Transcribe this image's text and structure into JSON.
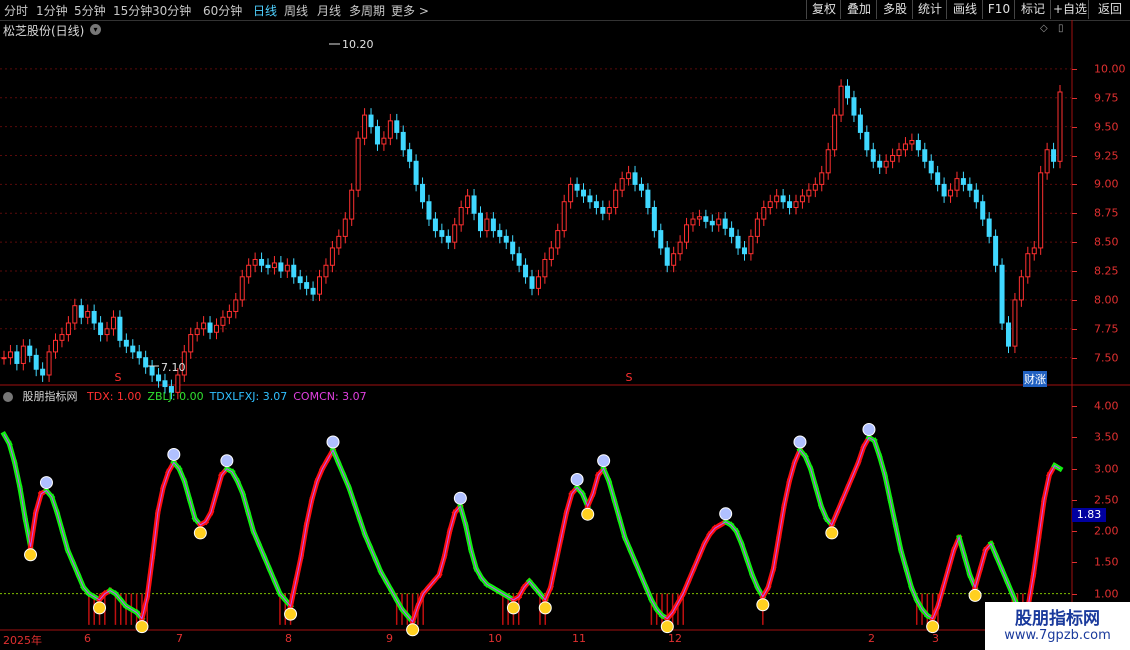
{
  "toolbar": {
    "periods": [
      "分时",
      "1分钟",
      "5分钟",
      "15分钟",
      "30分钟",
      "60分钟",
      "日线",
      "周线",
      "月线",
      "多周期",
      "更多 >"
    ],
    "active_period": "日线",
    "right_buttons": [
      "复权",
      "叠加",
      "多股",
      "统计",
      "画线",
      "F10",
      "标记",
      "+自选",
      "返回"
    ]
  },
  "main_chart": {
    "title": "松芝股份(日线)",
    "high_label": "10.20",
    "low_label": "7.10",
    "s_marker": "S",
    "badge": "财涨"
  },
  "indicator": {
    "name": "股朋指标网",
    "items": [
      {
        "label": "TDX: 1.00",
        "color": "#ff3030"
      },
      {
        "label": "ZBLJ: 0.00",
        "color": "#30e030"
      },
      {
        "label": "TDXLFXJ: 3.07",
        "color": "#30c0ff"
      },
      {
        "label": "COMCN: 3.07",
        "color": "#e040e0"
      }
    ],
    "current_value": "1.83"
  },
  "x_axis": {
    "year_label": "2025年",
    "months": [
      "6",
      "7",
      "8",
      "9",
      "10",
      "11",
      "12",
      "2",
      "3"
    ]
  },
  "watermark": {
    "line1": "股朋指标网",
    "line2": "www.7gpzb.com"
  },
  "chart_data": [
    {
      "type": "candlestick",
      "title": "松芝股份(日线)",
      "y_ticks": [
        "10.00",
        "9.75",
        "9.50",
        "9.25",
        "9.00",
        "8.75",
        "8.50",
        "8.25",
        "8.00",
        "7.75",
        "7.50"
      ],
      "ylim": [
        7.35,
        10.25
      ],
      "annotations": {
        "max": 10.2,
        "min": 7.1
      },
      "closes": [
        7.5,
        7.55,
        7.45,
        7.6,
        7.52,
        7.4,
        7.35,
        7.55,
        7.65,
        7.7,
        7.8,
        7.95,
        7.85,
        7.9,
        7.8,
        7.7,
        7.75,
        7.85,
        7.65,
        7.6,
        7.55,
        7.5,
        7.42,
        7.35,
        7.3,
        7.25,
        7.2,
        7.35,
        7.55,
        7.7,
        7.75,
        7.8,
        7.72,
        7.78,
        7.85,
        7.9,
        8.0,
        8.2,
        8.3,
        8.35,
        8.3,
        8.28,
        8.32,
        8.25,
        8.3,
        8.2,
        8.15,
        8.1,
        8.05,
        8.2,
        8.3,
        8.45,
        8.55,
        8.7,
        8.95,
        9.4,
        9.6,
        9.5,
        9.35,
        9.4,
        9.55,
        9.45,
        9.3,
        9.2,
        9.0,
        8.85,
        8.7,
        8.6,
        8.55,
        8.5,
        8.65,
        8.8,
        8.9,
        8.75,
        8.6,
        8.7,
        8.6,
        8.55,
        8.5,
        8.4,
        8.3,
        8.2,
        8.1,
        8.2,
        8.35,
        8.45,
        8.6,
        8.85,
        9.0,
        8.95,
        8.9,
        8.85,
        8.8,
        8.75,
        8.8,
        8.95,
        9.05,
        9.1,
        9.0,
        8.95,
        8.8,
        8.6,
        8.45,
        8.3,
        8.4,
        8.5,
        8.65,
        8.7,
        8.72,
        8.68,
        8.65,
        8.7,
        8.62,
        8.55,
        8.45,
        8.4,
        8.55,
        8.7,
        8.8,
        8.85,
        8.9,
        8.85,
        8.8,
        8.85,
        8.9,
        8.95,
        9.0,
        9.1,
        9.3,
        9.6,
        9.85,
        9.75,
        9.6,
        9.45,
        9.3,
        9.2,
        9.15,
        9.2,
        9.25,
        9.3,
        9.35,
        9.38,
        9.3,
        9.2,
        9.1,
        9.0,
        8.9,
        8.95,
        9.05,
        9.0,
        8.95,
        8.85,
        8.7,
        8.55,
        8.3,
        7.8,
        7.6,
        8.0,
        8.2,
        8.4,
        8.45,
        9.1,
        9.3,
        9.2,
        9.8
      ]
    },
    {
      "type": "line",
      "title": "股朋指标网",
      "y_ticks": [
        "4.00",
        "3.50",
        "3.00",
        "2.50",
        "2.00",
        "1.50",
        "1.00",
        "0.50"
      ],
      "ylim": [
        0.45,
        4.1
      ],
      "series": [
        {
          "name": "TDXLFXJ",
          "values": [
            3.55,
            3.4,
            3.1,
            2.7,
            2.2,
            1.75,
            2.3,
            2.6,
            2.65,
            2.55,
            2.3,
            2.0,
            1.7,
            1.5,
            1.3,
            1.1,
            1.0,
            0.95,
            0.9,
            1.0,
            1.05,
            1.0,
            0.9,
            0.8,
            0.75,
            0.7,
            0.6,
            0.95,
            1.6,
            2.3,
            2.7,
            2.95,
            3.1,
            3.0,
            2.8,
            2.5,
            2.2,
            2.1,
            2.15,
            2.3,
            2.6,
            2.9,
            3.0,
            2.95,
            2.8,
            2.6,
            2.3,
            2.0,
            1.8,
            1.6,
            1.4,
            1.2,
            1.0,
            0.9,
            0.8,
            1.2,
            1.6,
            2.1,
            2.5,
            2.8,
            3.0,
            3.15,
            3.3,
            3.1,
            2.9,
            2.7,
            2.45,
            2.2,
            1.95,
            1.75,
            1.55,
            1.35,
            1.2,
            1.05,
            0.9,
            0.75,
            0.65,
            0.55,
            0.8,
            1.0,
            1.1,
            1.2,
            1.3,
            1.6,
            2.0,
            2.3,
            2.4,
            2.1,
            1.7,
            1.4,
            1.25,
            1.15,
            1.1,
            1.05,
            1.0,
            0.95,
            0.9,
            0.95,
            1.1,
            1.2,
            1.1,
            1.0,
            0.9,
            1.1,
            1.5,
            1.9,
            2.3,
            2.6,
            2.7,
            2.6,
            2.4,
            2.6,
            2.9,
            3.0,
            2.8,
            2.5,
            2.2,
            1.9,
            1.7,
            1.5,
            1.3,
            1.1,
            0.9,
            0.75,
            0.65,
            0.6,
            0.7,
            0.85,
            1.0,
            1.2,
            1.4,
            1.6,
            1.8,
            1.95,
            2.05,
            2.1,
            2.15,
            2.1,
            2.0,
            1.8,
            1.55,
            1.3,
            1.1,
            0.95,
            1.1,
            1.4,
            1.9,
            2.4,
            2.8,
            3.1,
            3.3,
            3.2,
            3.0,
            2.7,
            2.4,
            2.2,
            2.1,
            2.3,
            2.5,
            2.7,
            2.9,
            3.1,
            3.35,
            3.5,
            3.45,
            3.2,
            2.9,
            2.5,
            2.1,
            1.7,
            1.4,
            1.1,
            0.9,
            0.75,
            0.65,
            0.6,
            0.8,
            1.1,
            1.4,
            1.7,
            1.9,
            1.6,
            1.3,
            1.1,
            1.4,
            1.7,
            1.8,
            1.6,
            1.4,
            1.2,
            1.0,
            0.8,
            0.6,
            0.8,
            1.3,
            1.9,
            2.5,
            2.9,
            3.05,
            3.0
          ]
        }
      ]
    }
  ]
}
